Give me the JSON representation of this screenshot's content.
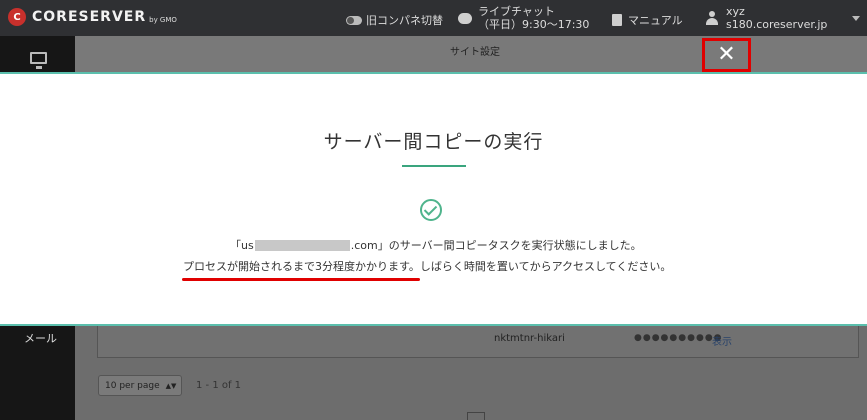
{
  "topbar": {
    "logo_badge": "C",
    "logo_text": "CORESERVER",
    "logo_sub": "by GMO",
    "legacy_panel_label": "旧コンパネ切替",
    "live_chat_label": "ライブチャット",
    "live_chat_hours": "（平日）9:30～17:30",
    "manual_label": "マニュアル",
    "user_name": "xyz",
    "user_host": "s180.coreserver.jp"
  },
  "sidebar": {
    "mail_label": "メール"
  },
  "site_settings": {
    "title": "サイト設定"
  },
  "modal": {
    "title": "サーバー間コピーの実行",
    "msg1_prefix": "「us",
    "msg1_suffix": ".com」のサーバー間コピータスクを実行状態にしました。",
    "msg2": "プロセスが開始されるまで3分程度かかります。しばらく時間を置いてからアクセスしてください。",
    "close_symbol": "✕"
  },
  "table": {
    "username": "nktmtnr-hikari",
    "password_mask": "●●●●●●●●●●",
    "show_label": "表示"
  },
  "pagination": {
    "per_page": "10 per page",
    "range": "1 - 1 of 1"
  },
  "colors": {
    "accent_teal": "#5bbfad",
    "success_green": "#4fb48c",
    "highlight_red": "#e00000"
  }
}
